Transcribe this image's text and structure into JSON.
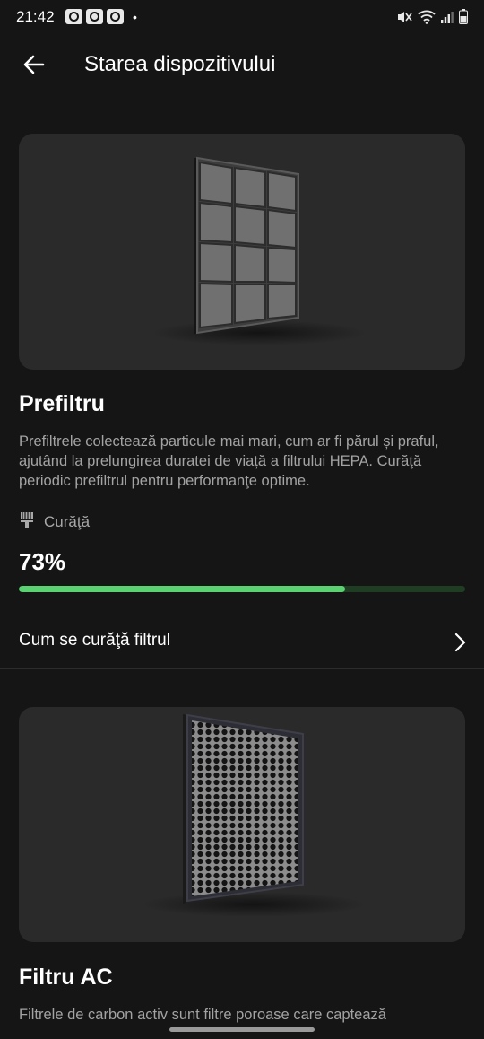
{
  "status_bar": {
    "time": "21:42",
    "notification_icons": [
      "app-notification-icon",
      "app-notification-icon",
      "app-notification-icon"
    ],
    "dot": "•"
  },
  "header": {
    "title": "Starea dispozitivului"
  },
  "prefilter": {
    "title": "Prefiltru",
    "description": "Prefiltrele colectează particule mai mari, cum ar fi părul și praful, ajutând la prelungirea duratei de viață a filtrului HEPA. Curăţă periodic prefiltrul pentru performanţe optime.",
    "state_label": "Curăţă",
    "percent_text": "73%",
    "progress": 0.73,
    "link_label": "Cum se curăţă filtrul"
  },
  "ac_filter": {
    "title": "Filtru AC",
    "description": "Filtrele de carbon activ sunt filtre poroase care captează"
  },
  "colors": {
    "background": "#151515",
    "card": "#2a2a2a",
    "progress_fill": "#5bd272",
    "progress_track": "#1f3d23"
  }
}
